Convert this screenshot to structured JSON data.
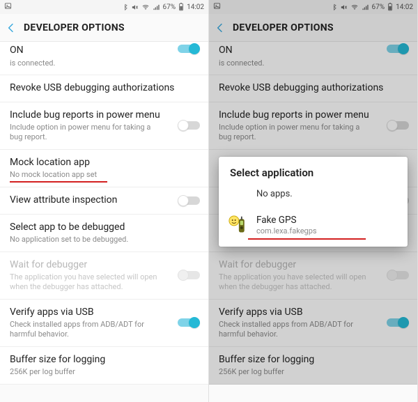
{
  "status": {
    "battery": "67%",
    "time": "14:02"
  },
  "header": {
    "title": "DEVELOPER OPTIONS"
  },
  "rows": {
    "on": {
      "title": "ON",
      "sub": "is connected."
    },
    "revoke": {
      "title": "Revoke USB debugging authorizations"
    },
    "bugreport": {
      "title": "Include bug reports in power menu",
      "sub": "Include option in power menu for taking a bug report."
    },
    "mock": {
      "title": "Mock location app",
      "sub": "No mock location app set"
    },
    "viewattr": {
      "title": "View attribute inspection"
    },
    "selectapp": {
      "title": "Select app to be debugged",
      "sub": "No application set to be debugged."
    },
    "waitdbg": {
      "title": "Wait for debugger",
      "sub": "The application you have selected will open when the debugger has attached."
    },
    "verify": {
      "title": "Verify apps via USB",
      "sub": "Check installed apps from ADB/ADT for harmful behavior."
    },
    "buffer": {
      "title": "Buffer size for logging",
      "sub": "256K per log buffer"
    }
  },
  "dialog": {
    "title": "Select application",
    "noapps": "No apps.",
    "app_name": "Fake GPS",
    "app_pkg": "com.lexa.fakegps"
  }
}
